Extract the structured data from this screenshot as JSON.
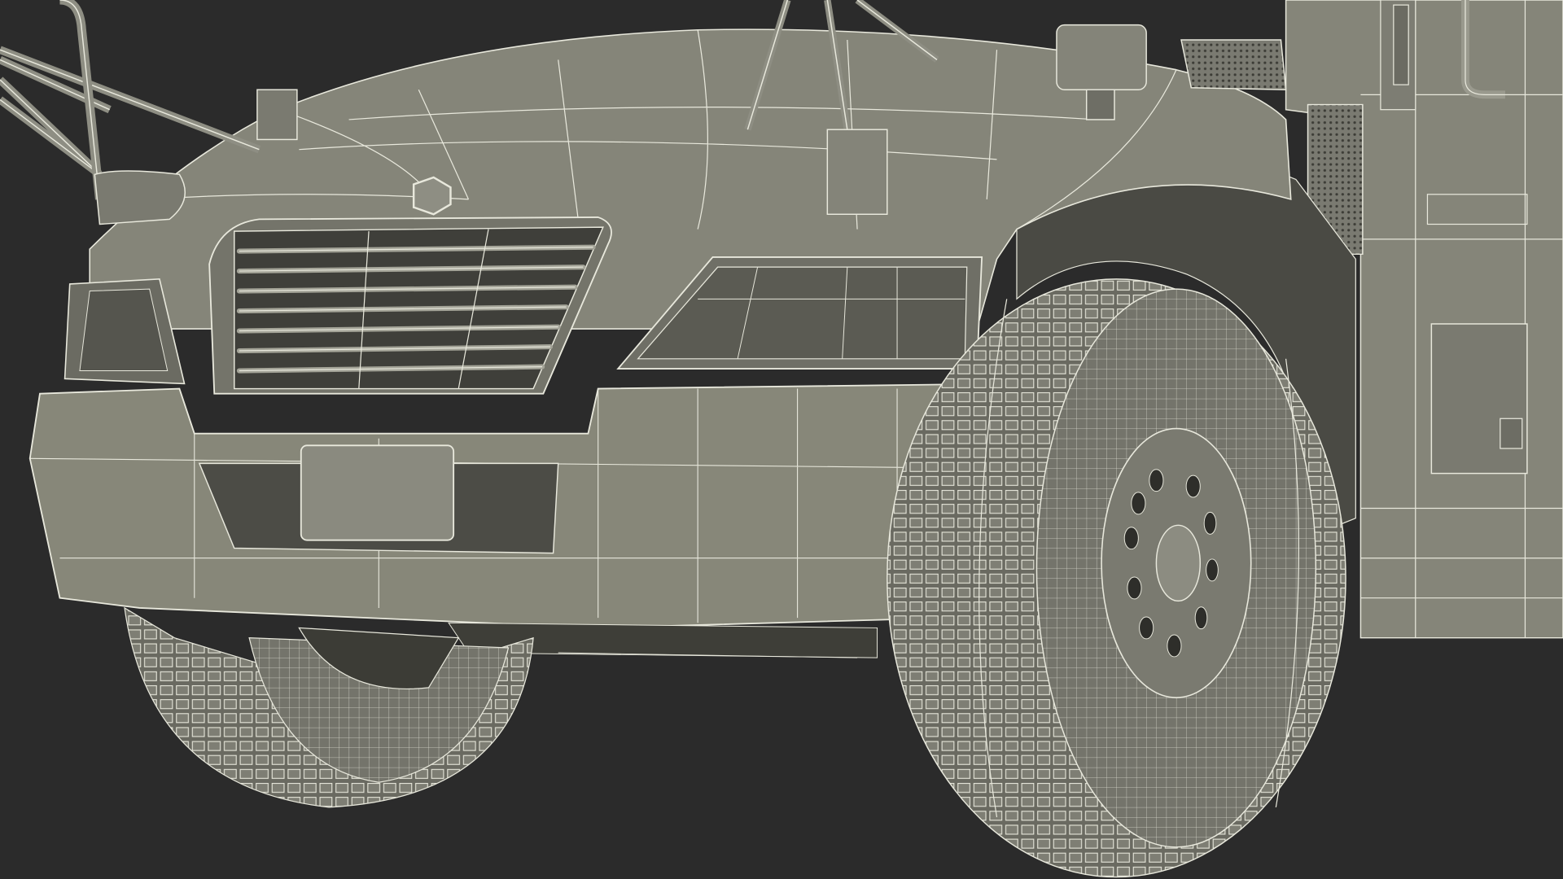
{
  "scene": {
    "subject": "",
    "colors": {
      "background": "#2b2b2b",
      "body": "#7d7d73",
      "body_light": "#8f8f84",
      "body_dark": "#5e5e55",
      "wire": "#e8e8dc",
      "tire": "#6f6f66",
      "shadow": "#3a3a35"
    }
  }
}
